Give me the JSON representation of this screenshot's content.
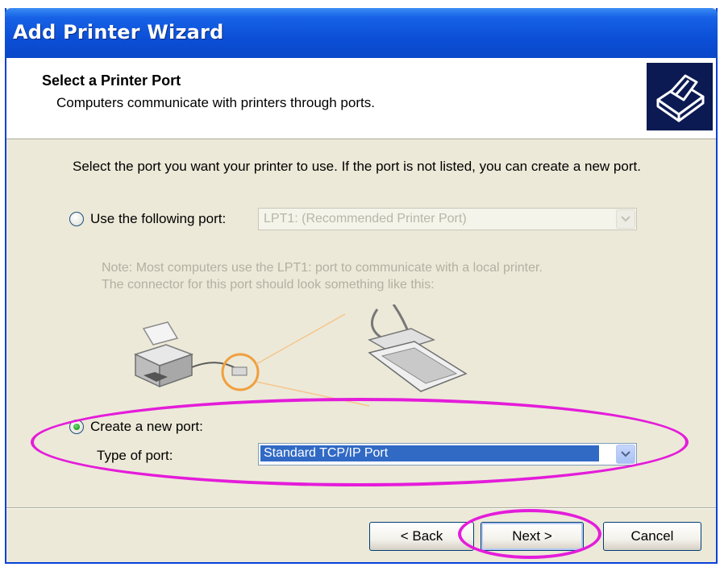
{
  "window": {
    "title": "Add Printer Wizard"
  },
  "header": {
    "title": "Select a Printer Port",
    "subtitle": "Computers communicate with printers through ports.",
    "icon": "printer-icon"
  },
  "body": {
    "instructions": "Select the port you want your printer to use.  If the port is not listed, you can create a new port."
  },
  "use_port": {
    "label": "Use the following port:",
    "selected": false,
    "dropdown_value": "LPT1: (Recommended Printer Port)",
    "enabled": false
  },
  "note": {
    "line1": "Note: Most computers use the LPT1: port to communicate with a local printer.",
    "line2": "The connector for this port should look something like this:"
  },
  "create_port": {
    "label": "Create a new port:",
    "selected": true,
    "type_label": "Type of port:",
    "dropdown_value": "Standard TCP/IP Port"
  },
  "buttons": {
    "back": "< Back",
    "next": "Next >",
    "cancel": "Cancel"
  },
  "colors": {
    "title_bar": "#0b4fd6",
    "dialog_bg": "#ece9d8",
    "highlight_annotation": "#e41cda",
    "selection": "#316ac5"
  }
}
